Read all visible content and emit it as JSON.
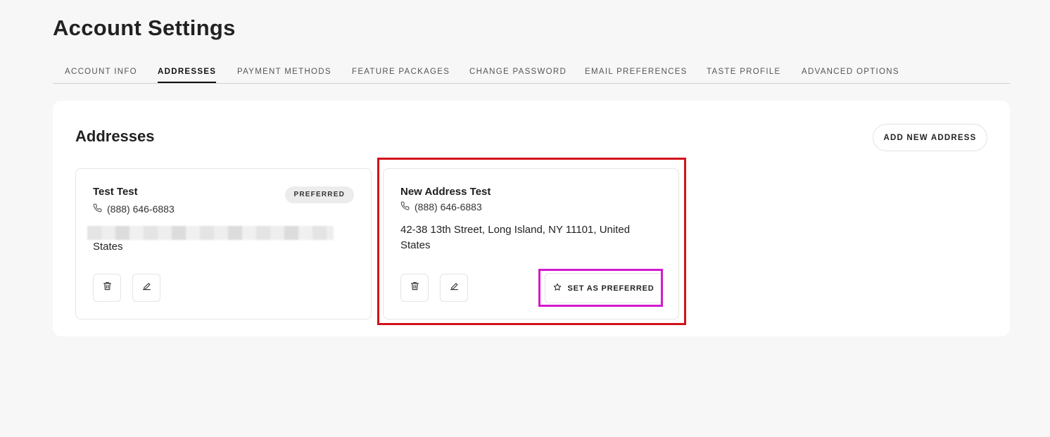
{
  "page": {
    "title": "Account Settings"
  },
  "tabs": [
    {
      "label": "ACCOUNT INFO"
    },
    {
      "label": "ADDRESSES"
    },
    {
      "label": "PAYMENT METHODS"
    },
    {
      "label": "FEATURE PACKAGES"
    },
    {
      "label": "CHANGE PASSWORD"
    },
    {
      "label": "EMAIL PREFERENCES"
    },
    {
      "label": "TASTE PROFILE"
    },
    {
      "label": "ADVANCED OPTIONS"
    }
  ],
  "active_tab": "ADDRESSES",
  "addresses": {
    "title": "Addresses",
    "add_button": "ADD NEW ADDRESS",
    "cards": [
      {
        "name": "Test Test",
        "phone": "(888) 646-6883",
        "badge": "PREFERRED",
        "address_visible": "States"
      },
      {
        "name": "New Address Test",
        "phone": "(888) 646-6883",
        "address": "42-38 13th Street, Long Island, NY 11101, United States",
        "preferred_button": "SET AS PREFERRED"
      }
    ]
  },
  "colors": {
    "highlight_red": "#d2111a",
    "highlight_magenta": "#d21ad0",
    "background": "#f7f7f7"
  }
}
